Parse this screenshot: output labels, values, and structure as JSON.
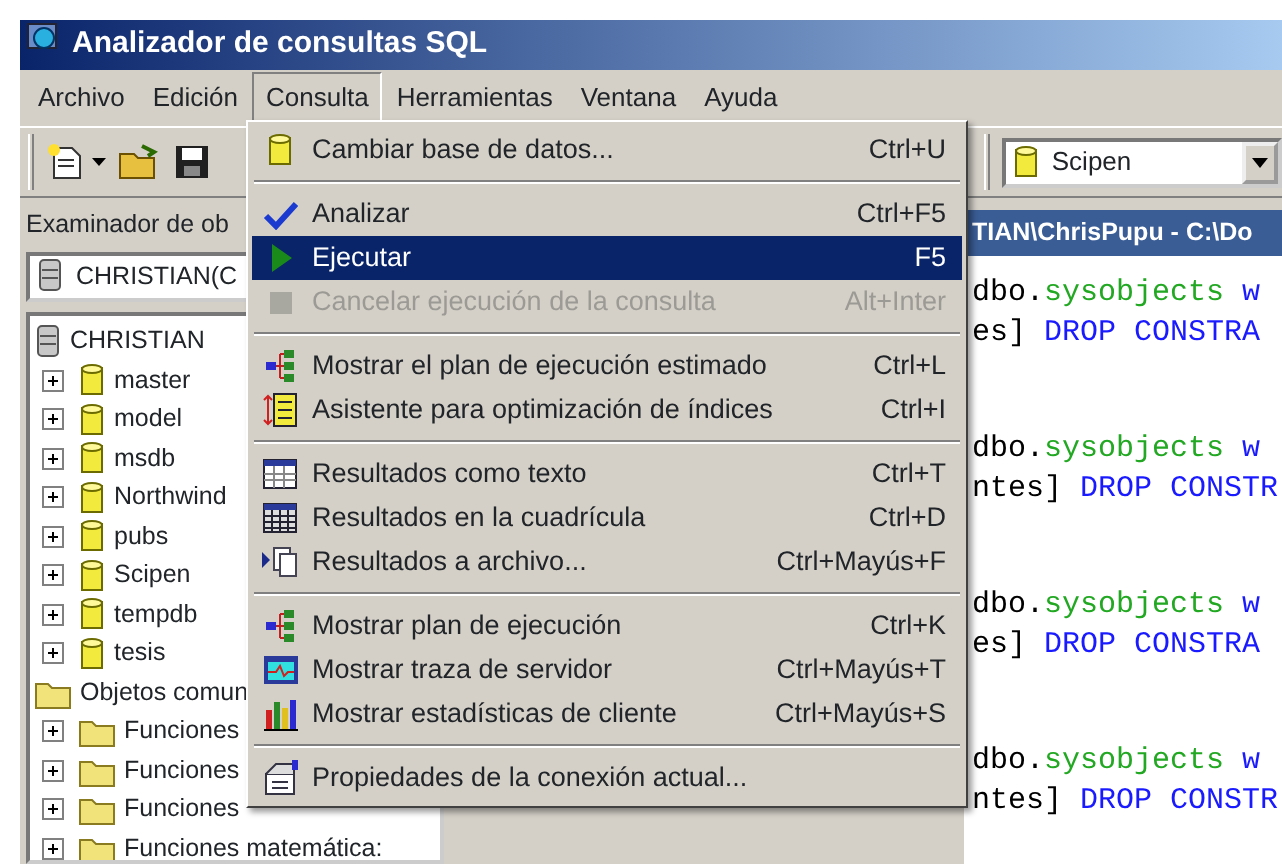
{
  "window": {
    "title": "Analizador de consultas SQL"
  },
  "menu_bar": [
    {
      "label": "Archivo",
      "selected": false
    },
    {
      "label": "Edición",
      "selected": false
    },
    {
      "label": "Consulta",
      "selected": true
    },
    {
      "label": "Herramientas",
      "selected": false
    },
    {
      "label": "Ventana",
      "selected": false
    },
    {
      "label": "Ayuda",
      "selected": false
    }
  ],
  "database_combo": {
    "value": "Scipen"
  },
  "object_browser": {
    "title": "Examinador de ob",
    "server_combo": "CHRISTIAN(C",
    "tree": [
      {
        "label": "CHRISTIAN",
        "kind": "server",
        "children": [
          {
            "label": "master",
            "kind": "database",
            "expanded": false
          },
          {
            "label": "model",
            "kind": "database",
            "expanded": false
          },
          {
            "label": "msdb",
            "kind": "database",
            "expanded": false
          },
          {
            "label": "Northwind",
            "kind": "database",
            "expanded": false
          },
          {
            "label": "pubs",
            "kind": "database",
            "expanded": false
          },
          {
            "label": "Scipen",
            "kind": "database",
            "expanded": false
          },
          {
            "label": "tempdb",
            "kind": "database",
            "expanded": false
          },
          {
            "label": "tesis",
            "kind": "database",
            "expanded": false
          }
        ]
      },
      {
        "label": "Objetos comun",
        "kind": "folder",
        "children": [
          {
            "label": "Funciones",
            "kind": "folder",
            "expanded": false
          },
          {
            "label": "Funciones",
            "kind": "folder",
            "expanded": false
          },
          {
            "label": "Funciones",
            "kind": "folder",
            "expanded": false
          },
          {
            "label": "Funciones matemática:",
            "kind": "folder",
            "expanded": false
          }
        ]
      }
    ]
  },
  "editor": {
    "title": "TIAN\\ChrisPupu - C:\\Do",
    "blocks": [
      {
        "lines": [
          [
            {
              "text": "dbo.",
              "kind": "plain"
            },
            {
              "text": "sysobjects",
              "kind": "object"
            },
            {
              "text": " w",
              "kind": "keyword"
            }
          ],
          [
            {
              "text": "es] ",
              "kind": "plain"
            },
            {
              "text": "DROP CONSTRA",
              "kind": "keyword"
            }
          ]
        ]
      },
      {
        "lines": [
          [
            {
              "text": "dbo.",
              "kind": "plain"
            },
            {
              "text": "sysobjects",
              "kind": "object"
            },
            {
              "text": " w",
              "kind": "keyword"
            }
          ],
          [
            {
              "text": "ntes] ",
              "kind": "plain"
            },
            {
              "text": "DROP CONSTR",
              "kind": "keyword"
            }
          ]
        ]
      },
      {
        "lines": [
          [
            {
              "text": "dbo.",
              "kind": "plain"
            },
            {
              "text": "sysobjects",
              "kind": "object"
            },
            {
              "text": " w",
              "kind": "keyword"
            }
          ],
          [
            {
              "text": "es] ",
              "kind": "plain"
            },
            {
              "text": "DROP CONSTRA",
              "kind": "keyword"
            }
          ]
        ]
      },
      {
        "lines": [
          [
            {
              "text": "dbo.",
              "kind": "plain"
            },
            {
              "text": "sysobjects",
              "kind": "object"
            },
            {
              "text": " w",
              "kind": "keyword"
            }
          ],
          [
            {
              "text": "ntes] ",
              "kind": "plain"
            },
            {
              "text": "DROP CONSTR",
              "kind": "keyword"
            }
          ]
        ]
      }
    ]
  },
  "dropdown_menu": [
    {
      "kind": "item",
      "label": "Cambiar base de datos...",
      "shortcut": "Ctrl+U",
      "selected": false,
      "disabled": false
    },
    {
      "kind": "separator"
    },
    {
      "kind": "item",
      "label": "Analizar",
      "shortcut": "Ctrl+F5",
      "selected": false,
      "disabled": false
    },
    {
      "kind": "item",
      "label": "Ejecutar",
      "shortcut": "F5",
      "selected": true,
      "disabled": false
    },
    {
      "kind": "item",
      "label": "Cancelar ejecución de la consulta",
      "shortcut": "Alt+Inter",
      "selected": false,
      "disabled": true
    },
    {
      "kind": "separator"
    },
    {
      "kind": "item",
      "label": "Mostrar el plan de ejecución estimado",
      "shortcut": "Ctrl+L",
      "selected": false,
      "disabled": false
    },
    {
      "kind": "item",
      "label": "Asistente para optimización de índices",
      "shortcut": "Ctrl+I",
      "selected": false,
      "disabled": false
    },
    {
      "kind": "separator"
    },
    {
      "kind": "item",
      "label": "Resultados como texto",
      "shortcut": "Ctrl+T",
      "selected": false,
      "disabled": false
    },
    {
      "kind": "item",
      "label": "Resultados en la cuadrícula",
      "shortcut": "Ctrl+D",
      "selected": false,
      "disabled": false
    },
    {
      "kind": "item",
      "label": "Resultados a archivo...",
      "shortcut": "Ctrl+Mayús+F",
      "selected": false,
      "disabled": false
    },
    {
      "kind": "separator"
    },
    {
      "kind": "item",
      "label": "Mostrar plan de ejecución",
      "shortcut": "Ctrl+K",
      "selected": false,
      "disabled": false
    },
    {
      "kind": "item",
      "label": "Mostrar traza de servidor",
      "shortcut": "Ctrl+Mayús+T",
      "selected": false,
      "disabled": false
    },
    {
      "kind": "item",
      "label": "Mostrar estadísticas de cliente",
      "shortcut": "Ctrl+Mayús+S",
      "selected": false,
      "disabled": false
    },
    {
      "kind": "separator"
    },
    {
      "kind": "item",
      "label": "Propiedades de la conexión actual...",
      "selected": false,
      "disabled": false
    }
  ]
}
